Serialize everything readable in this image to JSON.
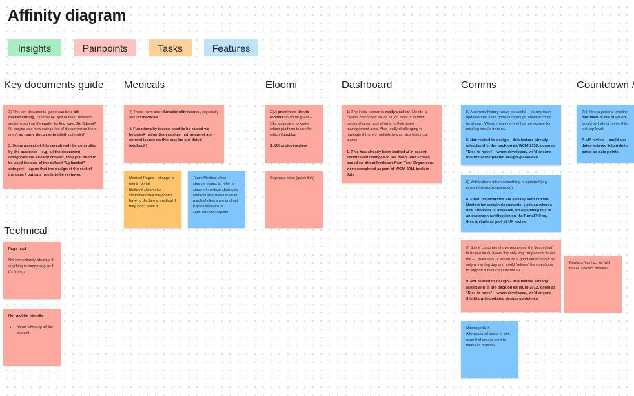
{
  "title": "Affinity diagram",
  "legend": [
    {
      "label": "Insights",
      "color": "#a8f0c4"
    },
    {
      "label": "Painpoints",
      "color": "#fec4c0"
    },
    {
      "label": "Tasks",
      "color": "#fed09a"
    },
    {
      "label": "Features",
      "color": "#bfe2fd"
    }
  ],
  "sections": {
    "key_docs": "Key documents guide",
    "medicals": "Medicals",
    "eloomi": "Eloomi",
    "dashboard": "Dashboard",
    "comms": "Comms",
    "countdown": "Countdown /",
    "technical": "Technical"
  },
  "stickies": {
    "key_docs_1": {
      "p1": [
        {
          "t": "3) The key documents guide can be a "
        },
        {
          "b": "bit overwhelming"
        },
        {
          "t": ", can this be split out into different sections so that it's "
        },
        {
          "b": "easier to find specific things"
        },
        {
          "t": "? Or maybe add new categories of document so there aren't "
        },
        {
          "b": "so many documents titled"
        },
        {
          "t": " 'uploaded'."
        }
      ],
      "p2": "3. Some aspect of this can already be controlled by the business – e.g. all the document categories are already created, they just need to be used instead of the default \"Uploaded\" category – agree that the design of the rest of the page / buttons needs to be reviewed"
    },
    "medicals_1": {
      "p1": [
        {
          "t": "4) There have been "
        },
        {
          "b": "functionality issues"
        },
        {
          "t": ", especially around "
        },
        {
          "b": "medicals"
        },
        {
          "t": "."
        }
      ],
      "p2": "4. Functionality issues need to be raised via helpdesk rather than design, not aware of any current issues so this may be out-dated feedback?"
    },
    "medicals_task": {
      "lines": [
        "Medical Pages - change to text in portal",
        "Makes it clearer to customers that they don't have to declare a medical if they don't have it"
      ]
    },
    "medicals_feature": {
      "lines": [
        "Team Medical View - change status to refer to stage of medical clearance",
        "Medical status will refer to medical clearance and not if questionnaire is complete/incomplete"
      ]
    },
    "eloomi_1": {
      "p1": [
        {
          "t": "2) A "
        },
        {
          "b": "prominent link to eloomi"
        },
        {
          "t": " would be great – SLs struggling to know which platform to use for which "
        },
        {
          "b": "function"
        }
      ],
      "p2": "2. UX project review"
    },
    "eloomi_2": {
      "text": "Seperate sites (quick link)"
    },
    "dashboard_1": {
      "p1": [
        {
          "t": "1) The initial screen is "
        },
        {
          "b": "really unclear"
        },
        {
          "t": ". Needs a clearer distinction for an SL on what is in their personal area, and what is in their team management area. Also really challenging to navigate if there's multiple teams, and historical teams"
        }
      ],
      "p2": "1. This has already been looked at in recent sprints with changes to the main Tour Screen based on direct feedback from Tour Organisers – work completed as part of WCM-2011 back in July"
    },
    "comms_1": {
      "p1": "5) A comms history would be useful – so any team updates that have gone out through Maslow could be shown. Would mean no-one has an excuse for missing emails from us.",
      "p2": "5. Not related to design – this feature already raised and in the backlog as WCM-2130, down as \"Nice to have\" – when developed, we'd ensure this fits with updated design guidelines"
    },
    "comms_2": {
      "p1": "6) Notifications when something is updated (e.g when trip pack is uploaded)",
      "p2": "6. Email notifications are already sent out via Maslow for certain documents, such as when a new Trip Pack is available, so assuming this is an onscreen notification on the Portal? If so, then include as part of UX review"
    },
    "comms_3": {
      "p1": "9) Some customers have requested the 'team chat' to be put back. It was the only way for parents to ask the EL questions. It would be a good service now as only a training day and could 'relieve' the questions to support if they can ask the EL.",
      "p2": "9. Not related to design – this feature already raised and in the backlog as WCM-2013, down as \"Nice to have\" – when developed, we'd ensure this fits with updated design guidelines"
    },
    "comms_4": {
      "lines": [
        "Message Hub",
        "Allows portal users to see record of emails sent to them via maslow"
      ]
    },
    "comms_5": {
      "text": "Replace 'contact us' with the EL contact details?"
    },
    "countdown_1": {
      "p1": [
        {
          "t": "7) I think a general timeline "
        },
        {
          "b": "overview of the build up"
        },
        {
          "t": " would be helpful, even if it's just top level."
        }
      ],
      "p2": "7. UX review – could use dates entered into Admin panel as data points"
    },
    "technical_1": {
      "heading": "Page load",
      "text": "Not immediately obvious if anything is happening or if it's frozen"
    },
    "technical_2": {
      "heading": "Not mobile friendly",
      "bullets": [
        "Menu takes up all the content"
      ]
    }
  }
}
